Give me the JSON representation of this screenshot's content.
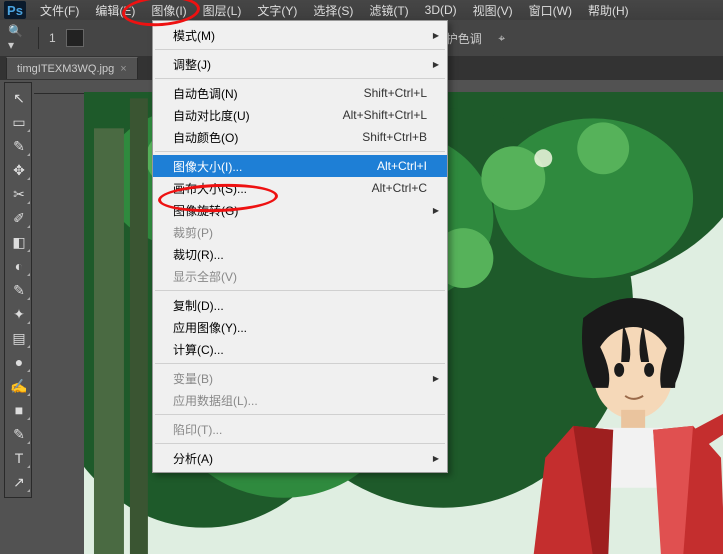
{
  "menubar": {
    "logo": "Ps",
    "items": [
      "文件(F)",
      "编辑(E)",
      "图像(I)",
      "图层(L)",
      "文字(Y)",
      "选择(S)",
      "滤镜(T)",
      "3D(D)",
      "视图(V)",
      "窗口(W)",
      "帮助(H)"
    ],
    "active_index": 2
  },
  "optionbar": {
    "opt1": "1",
    "protect": "保护色调"
  },
  "tab": {
    "name": "timgITEXM3WQ.jpg",
    "close": "×"
  },
  "dropdown": [
    {
      "type": "item",
      "label": "模式(M)",
      "sub": true
    },
    {
      "type": "sep"
    },
    {
      "type": "item",
      "label": "调整(J)",
      "sub": true
    },
    {
      "type": "sep"
    },
    {
      "type": "item",
      "label": "自动色调(N)",
      "shortcut": "Shift+Ctrl+L"
    },
    {
      "type": "item",
      "label": "自动对比度(U)",
      "shortcut": "Alt+Shift+Ctrl+L"
    },
    {
      "type": "item",
      "label": "自动颜色(O)",
      "shortcut": "Shift+Ctrl+B"
    },
    {
      "type": "sep"
    },
    {
      "type": "item",
      "label": "图像大小(I)...",
      "shortcut": "Alt+Ctrl+I",
      "selected": true
    },
    {
      "type": "item",
      "label": "画布大小(S)...",
      "shortcut": "Alt+Ctrl+C"
    },
    {
      "type": "item",
      "label": "图像旋转(G)",
      "sub": true
    },
    {
      "type": "item",
      "label": "裁剪(P)",
      "disabled": true
    },
    {
      "type": "item",
      "label": "裁切(R)..."
    },
    {
      "type": "item",
      "label": "显示全部(V)",
      "disabled": true
    },
    {
      "type": "sep"
    },
    {
      "type": "item",
      "label": "复制(D)..."
    },
    {
      "type": "item",
      "label": "应用图像(Y)..."
    },
    {
      "type": "item",
      "label": "计算(C)..."
    },
    {
      "type": "sep"
    },
    {
      "type": "item",
      "label": "变量(B)",
      "sub": true,
      "disabled": true
    },
    {
      "type": "item",
      "label": "应用数据组(L)...",
      "disabled": true
    },
    {
      "type": "sep"
    },
    {
      "type": "item",
      "label": "陷印(T)...",
      "disabled": true
    },
    {
      "type": "sep"
    },
    {
      "type": "item",
      "label": "分析(A)",
      "sub": true
    }
  ],
  "tools": [
    "↖",
    "▭",
    "✎",
    "✥",
    "✂",
    "✐",
    "◧",
    "◐",
    "✎",
    "✦",
    "▤",
    "●",
    "✍",
    "■",
    "✎",
    "T",
    "↗"
  ]
}
